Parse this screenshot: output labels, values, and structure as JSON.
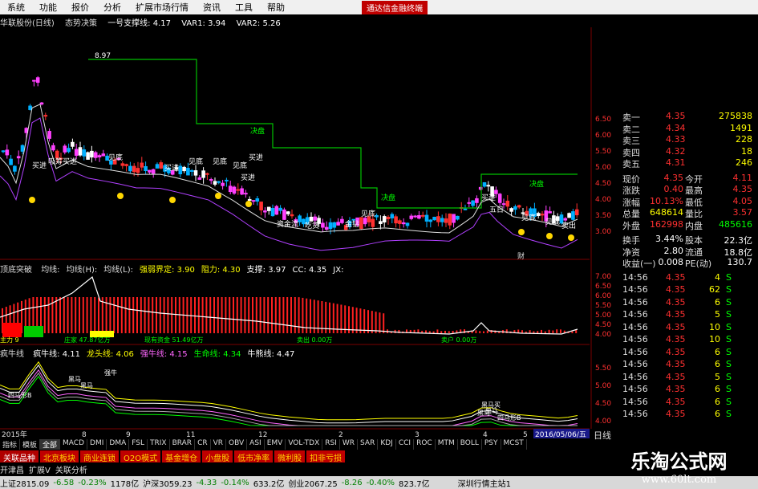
{
  "menu": [
    "系统",
    "功能",
    "报价",
    "分析",
    "扩展市场行情",
    "资讯",
    "工具",
    "帮助"
  ],
  "promo": "通达信金融终端",
  "title": {
    "stock": "华联股份(日线)",
    "indicator": "态势决策",
    "line1": "一号支撑线: 4.17",
    "line2": "",
    "var1": "VAR1: 3.94",
    "var2": "VAR2: 5.26"
  },
  "main_chart": {
    "labels": [
      "8.97",
      "买进",
      "见底",
      "买进",
      "见底",
      "见底",
      "见底",
      "买进",
      "买进",
      "决盘",
      "决盘",
      "决盘",
      "见底",
      "金钻",
      "见底",
      "见底",
      "卖出",
      "买进",
      "吸筹买进",
      "资金流",
      "吃货",
      "五日"
    ],
    "dates": [
      "2015年",
      "8",
      "9",
      "11",
      "12",
      "2",
      "3",
      "4",
      "5"
    ],
    "current_date": "2016/05/06/五",
    "right_scale": [
      "6.50",
      "6.00",
      "5.50",
      "5.00",
      "4.50",
      "4.00",
      "3.50",
      "3.00"
    ],
    "axis_tag": "财"
  },
  "ind1": {
    "title": "顶底突破",
    "items": [
      "均线:",
      "均线(H):",
      "均线(L):",
      "强弱界定: 3.90",
      "阻力: 4.30",
      "支撑: 3.97",
      "CC: 4.35",
      "JX:"
    ],
    "footer": [
      "主力 9",
      "庄家 47.87亿万",
      "现有资金 51.49亿万",
      "卖出 0.00万",
      "卖户 0.00万"
    ],
    "scale": [
      "7.00",
      "6.50",
      "6.00",
      "5.50",
      "5.00",
      "4.50",
      "4.00"
    ]
  },
  "ind2": {
    "title": "疯牛线",
    "items": [
      "疯牛线: 4.11",
      "龙头线: 4.06",
      "强牛线: 4.15",
      "生命线: 4.34",
      "牛熊线: 4.47"
    ],
    "labels": [
      "四马形B",
      "黑马",
      "强牛",
      "黑马",
      "黑马买",
      "黑马",
      "四马形B",
      "黑马"
    ],
    "scale": [
      "5.50",
      "5.00",
      "4.50",
      "4.00"
    ]
  },
  "quote": {
    "sells": [
      {
        "label": "卖一",
        "price": "4.35",
        "vol": "275838"
      },
      {
        "label": "卖二",
        "price": "4.34",
        "vol": "1491"
      },
      {
        "label": "卖三",
        "price": "4.33",
        "vol": "228"
      },
      {
        "label": "卖四",
        "price": "4.32",
        "vol": "18"
      },
      {
        "label": "卖五",
        "price": "4.31",
        "vol": "246"
      }
    ],
    "stats": [
      {
        "a": "现价",
        "b": "4.35",
        "c": "今开",
        "d": "4.11"
      },
      {
        "a": "涨跌",
        "b": "0.40",
        "c": "最高",
        "d": "4.35"
      },
      {
        "a": "涨幅",
        "b": "10.13%",
        "c": "最低",
        "d": "4.05"
      },
      {
        "a": "总量",
        "b": "648614",
        "c": "量比",
        "d": "3.57"
      },
      {
        "a": "外盘",
        "b": "162998",
        "c": "内盘",
        "d": "485616"
      }
    ],
    "fund": [
      {
        "a": "换手",
        "b": "3.44%",
        "c": "股本",
        "d": "22.3亿"
      },
      {
        "a": "净资",
        "b": "2.80",
        "c": "流通",
        "d": "18.8亿"
      },
      {
        "a": "收益(一)",
        "b": "0.008",
        "c": "PE(动)",
        "d": "130.7"
      }
    ],
    "ticks": [
      {
        "t": "14:56",
        "p": "4.35",
        "v": "4",
        "s": "S"
      },
      {
        "t": "14:56",
        "p": "4.35",
        "v": "62",
        "s": "S"
      },
      {
        "t": "14:56",
        "p": "4.35",
        "v": "6",
        "s": "S"
      },
      {
        "t": "14:56",
        "p": "4.35",
        "v": "5",
        "s": "S"
      },
      {
        "t": "14:56",
        "p": "4.35",
        "v": "10",
        "s": "S"
      },
      {
        "t": "14:56",
        "p": "4.35",
        "v": "10",
        "s": "S"
      },
      {
        "t": "14:56",
        "p": "4.35",
        "v": "6",
        "s": "S"
      },
      {
        "t": "14:56",
        "p": "4.35",
        "v": "6",
        "s": "S"
      },
      {
        "t": "14:56",
        "p": "4.35",
        "v": "5",
        "s": "S"
      },
      {
        "t": "14:56",
        "p": "4.35",
        "v": "6",
        "s": "S"
      },
      {
        "t": "14:56",
        "p": "4.35",
        "v": "6",
        "s": "S"
      },
      {
        "t": "14:56",
        "p": "4.35",
        "v": "6",
        "s": "S"
      },
      {
        "t": "14:56",
        "p": "4.35",
        "v": "6",
        "s": "S"
      }
    ],
    "period": "日线"
  },
  "tabs": [
    "指标",
    "模板",
    "全部",
    "MACD",
    "DMI",
    "DMA",
    "FSL",
    "TRIX",
    "BRAR",
    "CR",
    "VR",
    "OBV",
    "ASI",
    "EMV",
    "VOL-TDX",
    "RSI",
    "WR",
    "SAR",
    "KDJ",
    "CCI",
    "ROC",
    "MTM",
    "BOLL",
    "PSY",
    "MCST"
  ],
  "tabs2": [
    "关联品种",
    "北京板块",
    "商业连锁",
    "O2O模式",
    "基金增仓",
    "小盘股",
    "低市净率",
    "微利股",
    "扣非亏损"
  ],
  "status_left": [
    "开津昌",
    "扩展V",
    "关联分析"
  ],
  "statusbar": [
    "上证2815.09",
    "-6.58",
    "-0.23%",
    "1178亿",
    "沪深3059.23",
    "-4.33",
    "-0.14%",
    "633.2亿",
    "创业2067.25",
    "-8.26",
    "-0.40%",
    "823.7亿",
    "深圳行情主站1"
  ],
  "brand": {
    "cn": "乐淘公式网",
    "url": "www.60lt.com"
  },
  "colors": {
    "up": "#ff3030",
    "down": "#00e0e0",
    "panel": "#7a0000",
    "yellow": "#ffff00"
  }
}
